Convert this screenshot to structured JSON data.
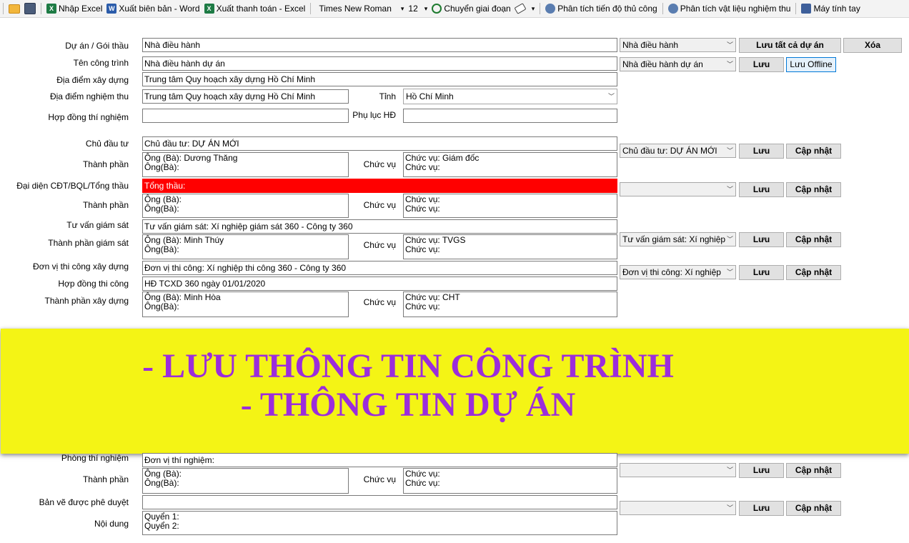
{
  "toolbar": {
    "import_excel": "Nhập Excel",
    "export_word": "Xuất biên bản - Word",
    "export_payment": "Xuất thanh toán - Excel",
    "font_name": "Times New Roman",
    "font_size": "12",
    "transfer_stage": "Chuyển giai đoạn",
    "analyze_progress": "Phân tích tiến độ thủ công",
    "analyze_materials": "Phân tích vật liệu nghiệm thu",
    "calculator": "Máy tính tay"
  },
  "form": {
    "project": {
      "label": "Dự án / Gói thầu",
      "value": "Nhà điều hành",
      "select": "Nhà điều hành"
    },
    "work_name": {
      "label": "Tên công trình",
      "value": "Nhà điều hành dự án",
      "select": "Nhà điều hành dự án"
    },
    "location": {
      "label": "Địa điểm xây dựng",
      "value": "Trung tâm Quy hoạch xây dựng Hồ Chí Minh"
    },
    "accept_location": {
      "label": "Địa điểm nghiệm thu",
      "value": "Trung tâm Quy hoạch xây dựng Hồ Chí Minh",
      "province_label": "Tỉnh",
      "province": "Hồ Chí Minh"
    },
    "contract": {
      "label": "Hợp đồng thí nghiệm",
      "value": "",
      "appendix_label": "Phụ lục HĐ",
      "appendix": ""
    },
    "investor": {
      "label": "Chủ đầu tư",
      "value": "Chủ đầu tư: DỰ ÁN MỚI",
      "select": "Chủ đầu tư: DỰ ÁN MỚI",
      "members_label": "Thành phần",
      "person1": "Ông (Bà): Dương Thăng",
      "person2": "Ông(Bà):",
      "role_label": "Chức vụ",
      "role1": "Chức vụ: Giám đốc",
      "role2": "Chức vụ:"
    },
    "representative": {
      "label": "Đại diện CĐT/BQL/Tổng thầu",
      "value": "Tổng thầu:",
      "select": "",
      "members_label": "Thành phần",
      "person1": "Ông (Bà):",
      "person2": "Ông(Bà):",
      "role_label": "Chức vụ",
      "role1": "Chức vụ:",
      "role2": "Chức vụ:"
    },
    "supervisor": {
      "label": "Tư vấn giám sát",
      "value": "Tư vấn giám sát: Xí nghiệp giám sát 360 - Công ty 360",
      "select": "Tư vấn giám sát: Xí nghiệp",
      "members_label": "Thành phần giám sát",
      "person1": "Ông (Bà): Minh Thúy",
      "person2": "Ông(Bà):",
      "role_label": "Chức vụ",
      "role1": "Chức vụ: TVGS",
      "role2": "Chức vụ:"
    },
    "contractor": {
      "label": "Đơn vị thi công xây dựng",
      "value": "Đơn vị thi công:  Xí nghiệp thi công 360 - Công ty 360",
      "select": "Đơn vị thi công:  Xí nghiệp",
      "contract_label": "Hợp đồng thi công",
      "contract_value": "HĐ TCXD 360 ngày 01/01/2020",
      "members_label": "Thành phần xây dựng",
      "person1": "Ông (Bà): Minh Hòa",
      "person2": "Ông(Bà):",
      "role_label": "Chức vụ",
      "role1": "Chức vụ: CHT",
      "role2": "Chức vụ:"
    },
    "lab": {
      "label": "Phòng thí nghiệm",
      "value": "Đơn vị thí nghiệm:",
      "select": "",
      "members_label": "Thành phần",
      "person1": "Ông (Bà):",
      "person2": "Ông(Bà):",
      "role_label": "Chức vụ",
      "role1": "Chức vụ:",
      "role2": "Chức vụ:"
    },
    "drawings": {
      "label": "Bản vẽ được phê duyệt",
      "value": "",
      "select": ""
    },
    "content": {
      "label": "Nội dung",
      "line1": "Quyển 1:",
      "line2": "Quyển 2:"
    }
  },
  "buttons": {
    "save_all": "Lưu tất cả dự án",
    "delete": "Xóa",
    "save": "Lưu",
    "save_offline": "Lưu Offline",
    "update": "Cập nhật"
  },
  "banner": {
    "line1": "- LƯU THÔNG TIN CÔNG TRÌNH",
    "line2": "- THÔNG TIN DỰ ÁN"
  },
  "colors": {
    "banner_bg": "#f4f415",
    "banner_text": "#9b2ddb",
    "highlight_red": "#ff0000"
  }
}
